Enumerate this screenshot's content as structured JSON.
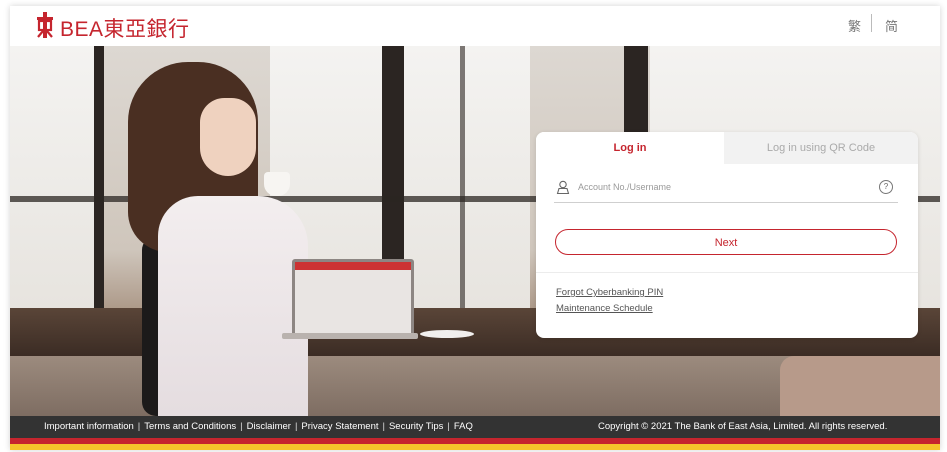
{
  "header": {
    "brand": "BEA東亞銀行",
    "lang_traditional": "繁",
    "lang_simplified": "简"
  },
  "login": {
    "tab_login": "Log in",
    "tab_qr": "Log in using QR Code",
    "username_placeholder": "Account No./Username",
    "help_symbol": "?",
    "next_label": "Next",
    "forgot_pin": "Forgot Cyberbanking PIN",
    "maintenance": "Maintenance Schedule"
  },
  "footer": {
    "links": [
      "Important information",
      "Terms and Conditions",
      "Disclaimer",
      "Privacy Statement",
      "Security Tips",
      "FAQ"
    ],
    "separator": "|",
    "copyright": "Copyright © 2021 The Bank of East Asia, Limited. All rights reserved."
  },
  "colors": {
    "brand_red": "#c5252e",
    "stripe_yellow": "#f5c52b",
    "footer_bg": "#333333"
  },
  "icons": [
    "bea-logo-icon",
    "user-icon",
    "help-icon"
  ]
}
